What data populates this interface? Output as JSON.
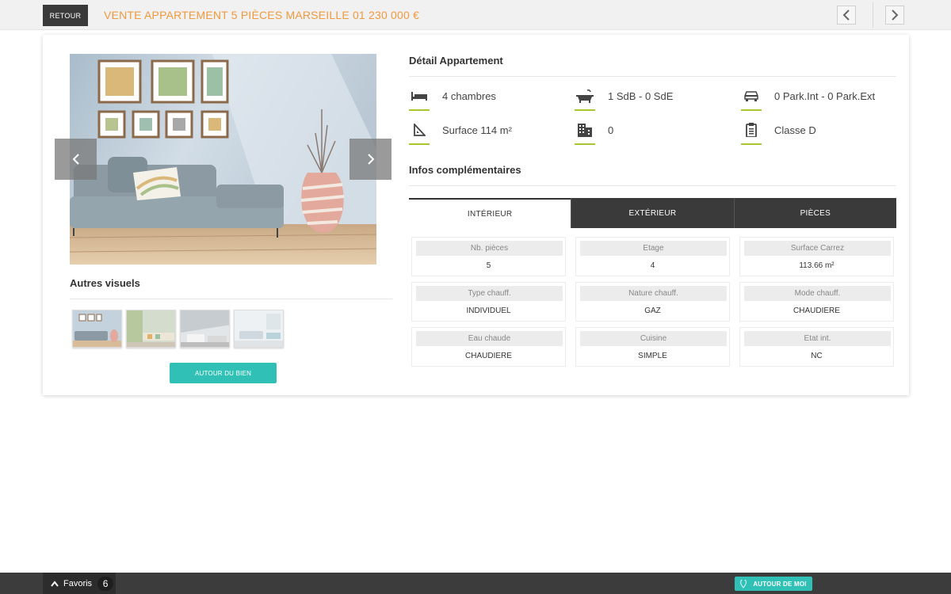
{
  "header": {
    "back_label": "RETOUR",
    "title": "VENTE APPARTEMENT 5 PIÈCES MARSEILLE 01 230 000 €",
    "title_color": "#f0993e"
  },
  "gallery": {
    "other_visuals_title": "Autres visuels",
    "around_property_label": "AUTOUR DU BIEN"
  },
  "details": {
    "title": "Détail Appartement",
    "items": [
      {
        "icon": "bed-icon",
        "text": "4 chambres"
      },
      {
        "icon": "bathtub-icon",
        "text": "1 SdB - 0 SdE"
      },
      {
        "icon": "car-icon",
        "text": "0 Park.Int - 0 Park.Ext"
      },
      {
        "icon": "set-square-icon",
        "text": "Surface 114 m²"
      },
      {
        "icon": "building-icon",
        "text": "0"
      },
      {
        "icon": "clipboard-icon",
        "text": "Classe D"
      }
    ],
    "underline_color": "#a8c630"
  },
  "extra": {
    "title": "Infos complémentaires",
    "tabs": [
      {
        "label": "INTÉRIEUR",
        "active": true
      },
      {
        "label": "EXTÉRIEUR",
        "active": false
      },
      {
        "label": "PIÈCES",
        "active": false
      }
    ],
    "cells": [
      {
        "label": "Nb. pièces",
        "value": "5"
      },
      {
        "label": "Etage",
        "value": "4"
      },
      {
        "label": "Surface Carrez",
        "value": "113.66 m²"
      },
      {
        "label": "Type chauff.",
        "value": "INDIVIDUEL"
      },
      {
        "label": "Nature chauff.",
        "value": "GAZ"
      },
      {
        "label": "Mode chauff.",
        "value": "CHAUDIERE"
      },
      {
        "label": "Eau chaude",
        "value": "CHAUDIERE"
      },
      {
        "label": "Cuisine",
        "value": "SIMPLE"
      },
      {
        "label": "Etat int.",
        "value": "NC"
      }
    ]
  },
  "footer": {
    "favorites_label": "Favoris",
    "favorites_count": "6",
    "around_me_label": "AUTOUR DE MOI",
    "accent_color": "#30c0b5"
  }
}
